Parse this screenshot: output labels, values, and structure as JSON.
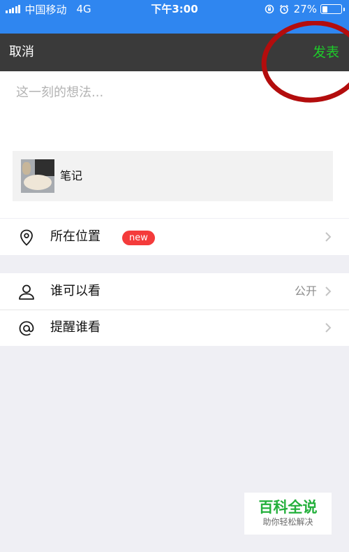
{
  "status_bar": {
    "carrier": "中国移动",
    "network": "4G",
    "time": "下午3:00",
    "battery_text": "27%",
    "battery_level": 0.27,
    "icons": [
      "signal-bars-icon",
      "rotation-lock-icon",
      "alarm-icon",
      "battery-icon"
    ]
  },
  "nav": {
    "cancel_label": "取消",
    "publish_label": "发表",
    "publish_color": "#1ecb2a"
  },
  "compose": {
    "placeholder": "这一刻的想法...",
    "value": "",
    "shared_item": {
      "title": "笔记",
      "thumbnail": "cat-photo-thumbnail"
    }
  },
  "location_section": {
    "label": "所在位置",
    "badge": "new",
    "icon": "location-pin-icon"
  },
  "privacy_section": {
    "rows": [
      {
        "label": "谁可以看",
        "value": "公开",
        "icon": "person-icon"
      },
      {
        "label": "提醒谁看",
        "value": "",
        "icon": "at-sign-icon"
      }
    ]
  },
  "watermark": {
    "title": "百科全说",
    "subtitle": "助你轻松解决"
  },
  "colors": {
    "status_bar_bg": "#2f86f0",
    "nav_bg": "#3a3a3a",
    "badge_red": "#f43b3b",
    "annotation_circle": "#b30d0d"
  }
}
